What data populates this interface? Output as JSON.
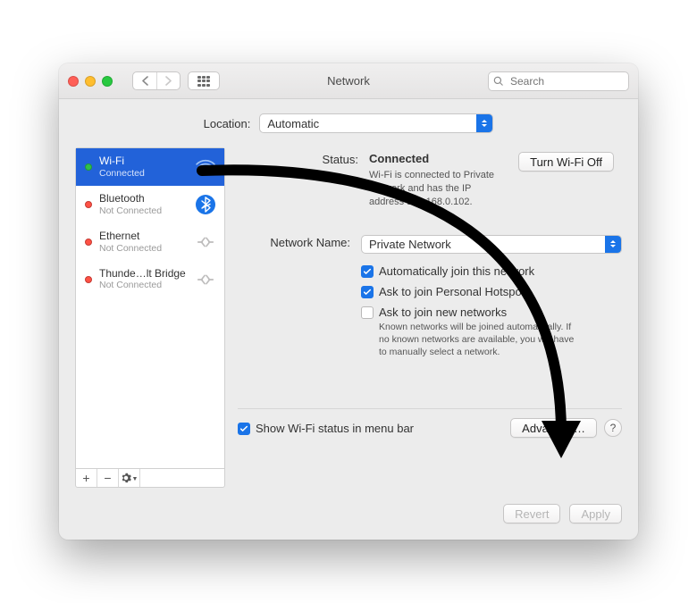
{
  "window": {
    "title": "Network"
  },
  "search": {
    "placeholder": "Search"
  },
  "location": {
    "label": "Location:",
    "value": "Automatic"
  },
  "sidebar": {
    "items": [
      {
        "name": "Wi-Fi",
        "sub": "Connected",
        "status": "green",
        "icon": "wifi",
        "selected": true
      },
      {
        "name": "Bluetooth",
        "sub": "Not Connected",
        "status": "red",
        "icon": "bluetooth"
      },
      {
        "name": "Ethernet",
        "sub": "Not Connected",
        "status": "red",
        "icon": "ethernet"
      },
      {
        "name": "Thunde…lt Bridge",
        "sub": "Not Connected",
        "status": "red",
        "icon": "thunderbolt"
      }
    ]
  },
  "status": {
    "label": "Status:",
    "value": "Connected",
    "turn_off_label": "Turn Wi-Fi Off",
    "desc": "Wi-Fi is connected to Private Network and has the IP address 192.168.0.102."
  },
  "network_name": {
    "label": "Network Name:",
    "value": "Private Network"
  },
  "checks": {
    "auto_join": {
      "label": "Automatically join this network",
      "checked": true
    },
    "hotspots": {
      "label": "Ask to join Personal Hotspots",
      "checked": true
    },
    "new_networks": {
      "label": "Ask to join new networks",
      "checked": false,
      "sub": "Known networks will be joined automatically. If no known networks are available, you will have to manually select a network."
    }
  },
  "bottom": {
    "show_status": {
      "label": "Show Wi-Fi status in menu bar",
      "checked": true
    },
    "advanced_label": "Advanced…",
    "help_label": "?"
  },
  "footer": {
    "revert": "Revert",
    "apply": "Apply"
  }
}
